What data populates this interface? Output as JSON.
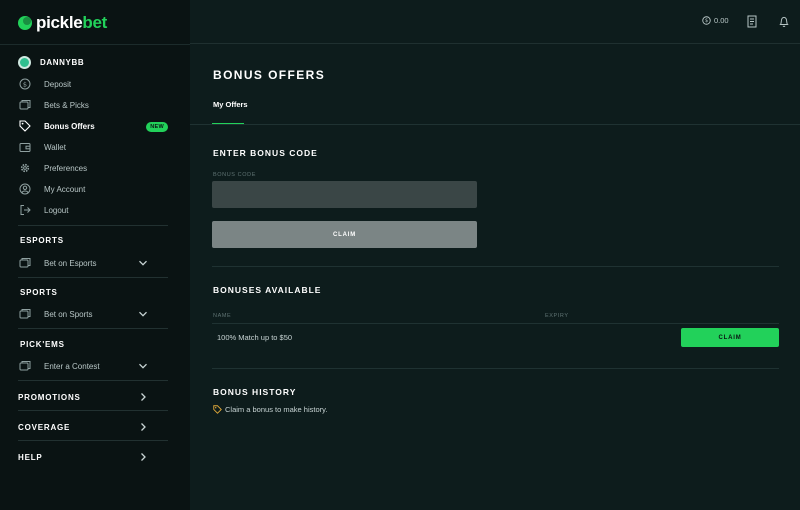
{
  "brand": {
    "name_prefix": "pickle",
    "name_suffix": "bet",
    "accent": "#22d15a"
  },
  "user": {
    "name": "DANNYBB"
  },
  "sidebar": {
    "account_items": [
      {
        "label": "Deposit",
        "icon": "dollar-circle-icon"
      },
      {
        "label": "Bets & Picks",
        "icon": "tickets-icon"
      },
      {
        "label": "Bonus Offers",
        "icon": "tag-icon",
        "badge": "NEW",
        "active": true
      },
      {
        "label": "Wallet",
        "icon": "wallet-icon"
      },
      {
        "label": "Preferences",
        "icon": "gear-icon"
      },
      {
        "label": "My Account",
        "icon": "user-circle-icon"
      },
      {
        "label": "Logout",
        "icon": "logout-icon"
      }
    ],
    "sections": [
      {
        "title": "ESPORTS",
        "item": "Bet on Esports"
      },
      {
        "title": "SPORTS",
        "item": "Bet on Sports"
      },
      {
        "title": "PICK'EMS",
        "item": "Enter a Contest"
      }
    ],
    "links": [
      {
        "title": "PROMOTIONS"
      },
      {
        "title": "COVERAGE"
      },
      {
        "title": "HELP"
      }
    ]
  },
  "header": {
    "balance": "0.00",
    "icons": [
      "dollar-circle-icon",
      "receipt-icon",
      "bell-icon"
    ]
  },
  "main": {
    "title": "BONUS OFFERS",
    "tabs": [
      {
        "label": "My Offers",
        "active": true
      }
    ],
    "enter_code": {
      "title": "ENTER BONUS CODE",
      "field_label": "BONUS CODE",
      "value": "",
      "placeholder": "",
      "button": "CLAIM"
    },
    "available": {
      "title": "BONUSES AVAILABLE",
      "columns": [
        "NAME",
        "EXPIRY"
      ],
      "rows": [
        {
          "name": "100% Match up to $50",
          "expiry": "",
          "button": "CLAIM"
        }
      ]
    },
    "history": {
      "title": "BONUS HISTORY",
      "empty_text": "Claim a bonus to make history."
    }
  }
}
